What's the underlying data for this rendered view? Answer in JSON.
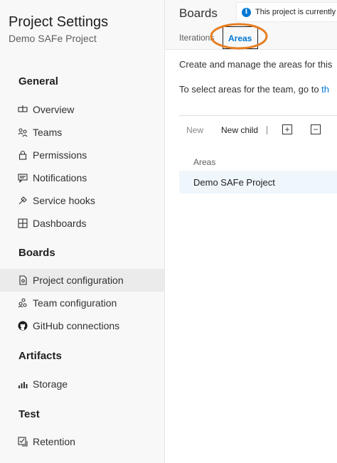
{
  "sidebar": {
    "title": "Project Settings",
    "subtitle": "Demo SAFe Project",
    "sections": {
      "general": "General",
      "boards": "Boards",
      "artifacts": "Artifacts",
      "test": "Test"
    },
    "items": {
      "overview": {
        "label": "Overview",
        "icon": "overview-icon"
      },
      "teams": {
        "label": "Teams",
        "icon": "teams-icon"
      },
      "permissions": {
        "label": "Permissions",
        "icon": "lock-icon"
      },
      "notifications": {
        "label": "Notifications",
        "icon": "chat-icon"
      },
      "service_hooks": {
        "label": "Service hooks",
        "icon": "plug-icon"
      },
      "dashboards": {
        "label": "Dashboards",
        "icon": "dashboard-icon"
      },
      "project_configuration": {
        "label": "Project configuration",
        "icon": "config-icon",
        "selected": true
      },
      "team_configuration": {
        "label": "Team configuration",
        "icon": "team-config-icon"
      },
      "github_connections": {
        "label": "GitHub connections",
        "icon": "github-icon"
      },
      "storage": {
        "label": "Storage",
        "icon": "chart-icon"
      },
      "retention": {
        "label": "Retention",
        "icon": "retention-icon"
      }
    }
  },
  "main": {
    "title": "Boards",
    "banner": "This project is currently",
    "tabs": {
      "iterations": "Iterations",
      "areas": "Areas"
    },
    "active_tab": "Areas",
    "description": "Create and manage the areas for this",
    "team_hint_prefix": "To select areas for the team, go to ",
    "team_hint_link": "th",
    "toolbar": {
      "new": "New",
      "new_child": "New child",
      "expand": "+",
      "collapse": "−"
    },
    "table": {
      "column": "Areas",
      "rows": [
        "Demo SAFe Project"
      ]
    }
  },
  "colors": {
    "accent": "#0078d4",
    "highlight": "#e67e22",
    "selected_bg": "#ebebeb"
  }
}
